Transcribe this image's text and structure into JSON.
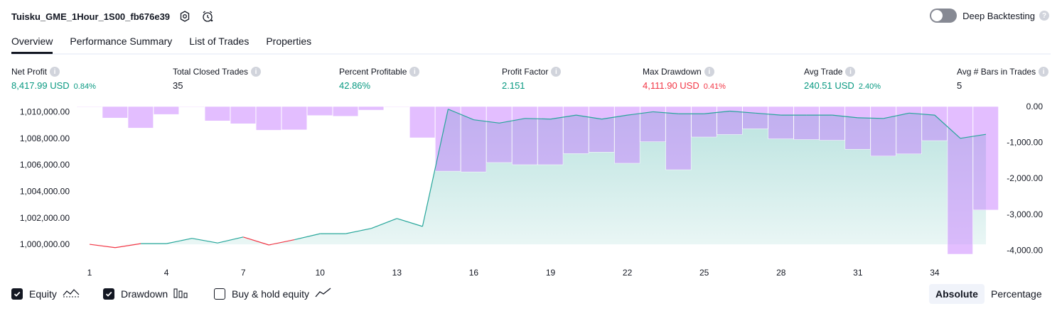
{
  "header": {
    "strategy_name": "Tuisku_GME_1Hour_1S00_fb676e39",
    "icons": [
      "settings-icon",
      "alert-clock-icon"
    ],
    "deep_backtesting_label": "Deep Backtesting",
    "deep_backtesting_enabled": false
  },
  "tabs": [
    {
      "label": "Overview",
      "active": true
    },
    {
      "label": "Performance Summary",
      "active": false
    },
    {
      "label": "List of Trades",
      "active": false
    },
    {
      "label": "Properties",
      "active": false
    }
  ],
  "metrics": [
    {
      "label": "Net Profit",
      "value": "8,417.99 USD",
      "pct": "0.84%"
    },
    {
      "label": "Total Closed Trades",
      "value": "35",
      "pct": ""
    },
    {
      "label": "Percent Profitable",
      "value": "42.86%",
      "pct": ""
    },
    {
      "label": "Profit Factor",
      "value": "2.151",
      "pct": ""
    },
    {
      "label": "Max Drawdown",
      "value": "4,111.90 USD",
      "pct": "0.41%"
    },
    {
      "label": "Avg Trade",
      "value": "240.51 USD",
      "pct": "2.40%"
    },
    {
      "label": "Avg # Bars in Trades",
      "value": "5",
      "pct": ""
    }
  ],
  "colors": {
    "positive": "#089981",
    "negative": "#f23645",
    "drawdown_bar": "#c77dff",
    "equity_area": "#26a69a"
  },
  "chart_data": {
    "type": "area",
    "x": [
      1,
      2,
      3,
      4,
      5,
      6,
      7,
      8,
      9,
      10,
      11,
      12,
      13,
      14,
      15,
      16,
      17,
      18,
      19,
      20,
      21,
      22,
      23,
      24,
      25,
      26,
      27,
      28,
      29,
      30,
      31,
      32,
      33,
      34,
      35,
      36
    ],
    "x_ticks": [
      "1",
      "4",
      "7",
      "10",
      "13",
      "16",
      "19",
      "22",
      "25",
      "28",
      "31",
      "34"
    ],
    "y_left_ticks": [
      "1,010,000.00",
      "1,008,000.00",
      "1,006,000.00",
      "1,004,000.00",
      "1,002,000.00",
      "1,000,000.00"
    ],
    "y_right_ticks": [
      "0.00",
      "-1,000.00",
      "-2,000.00",
      "-3,000.00",
      "-4,000.00"
    ],
    "left_ylim": [
      999200,
      1010400
    ],
    "right_ylim": [
      -4130,
      0
    ],
    "series": [
      {
        "name": "Equity",
        "axis": "left",
        "values": [
          1000000,
          999750,
          1000050,
          1000050,
          1000450,
          1000100,
          1000550,
          999950,
          1000350,
          1000800,
          1000800,
          1001200,
          1001950,
          1001350,
          1010200,
          1009400,
          1009150,
          1009500,
          1009450,
          1009750,
          1009450,
          1009750,
          1010000,
          1009850,
          1009850,
          1010050,
          1009900,
          1009750,
          1009750,
          1009750,
          1009550,
          1009500,
          1009900,
          1009750,
          1008000,
          1008300
        ]
      },
      {
        "name": "Drawdown",
        "axis": "right",
        "values": [
          0,
          -320,
          -600,
          -220,
          0,
          -400,
          -480,
          -660,
          -650,
          -250,
          -270,
          -100,
          0,
          -870,
          -1800,
          -1820,
          -1560,
          -1620,
          -1620,
          -1310,
          -1270,
          -1580,
          -980,
          -1760,
          -850,
          -780,
          -620,
          -900,
          -920,
          -940,
          -1190,
          -1380,
          -1320,
          -950,
          -4110,
          -2880
        ]
      }
    ],
    "legend": [
      {
        "name": "Equity",
        "checked": true,
        "icon": "equity-line-icon"
      },
      {
        "name": "Drawdown",
        "checked": true,
        "icon": "drawdown-bars-icon"
      },
      {
        "name": "Buy & hold equity",
        "checked": false,
        "icon": "buy-hold-line-icon"
      }
    ],
    "grid": false
  },
  "scale_toggle": {
    "options": [
      "Absolute",
      "Percentage"
    ],
    "selected": "Absolute"
  }
}
